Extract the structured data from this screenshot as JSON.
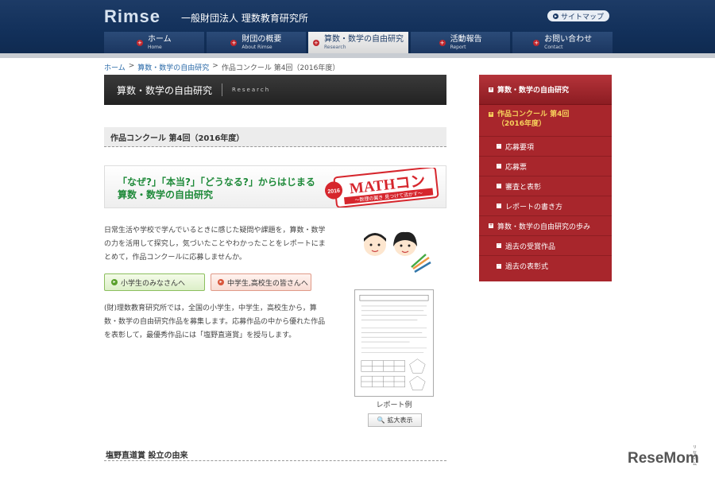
{
  "header": {
    "logo": "Rimse",
    "org_name": "一般財団法人 理数教育研究所",
    "sitemap": "サイトマップ"
  },
  "nav": [
    {
      "jp": "ホーム",
      "en": "Home"
    },
    {
      "jp": "財団の概要",
      "en": "About Rimse"
    },
    {
      "jp": "算数・数学の自由研究",
      "en": "Research"
    },
    {
      "jp": "活動報告",
      "en": "Report"
    },
    {
      "jp": "お問い合わせ",
      "en": "Contact"
    }
  ],
  "breadcrumb": {
    "home": "ホーム",
    "sep": ">",
    "research": "算数・数学の自由研究",
    "current": "作品コンクール 第4回（2016年度）"
  },
  "section_head": {
    "jp": "算数・数学の自由研究",
    "en": "Research"
  },
  "page_title": "作品コンクール 第4回（2016年度）",
  "banner": {
    "line1": "「なぜ?」「本当?」「どうなる?」からはじまる",
    "line2": "算数・数学の自由研究",
    "logo_year": "2016",
    "logo_main": "MATHコン",
    "logo_sub": "〜数理の翼き 見つけて活かす〜"
  },
  "intro": "日常生活や学校で学んでいるときに感じた疑問や課題を，算数・数学の力を活用して探究し，気づいたことやわかったことをレポートにまとめて，作品コンクールに応募しませんか。",
  "buttons": {
    "elementary": "小学生のみなさんへ",
    "secondary": "中学生,高校生の皆さんへ"
  },
  "description": "(財)理数教育研究所では，全国の小学生，中学生，高校生から，算数・数学の自由研究作品を募集します。応募作品の中から優れた作品を表彰して，最優秀作品には「塩野直道賞」を授与します。",
  "report": {
    "caption": "レポート例",
    "zoom": "拡大表示"
  },
  "section2_title": "塩野直道賞 設立の由来",
  "sidebar": {
    "head": "算数・数学の自由研究",
    "selected_line1": "作品コンクール 第4回",
    "selected_line2": "（2016年度）",
    "sub": [
      "応募要項",
      "応募票",
      "審査と表彰",
      "レポートの書き方"
    ],
    "main2": "算数・数学の自由研究の歩み",
    "sub2": [
      "過去の受賞作品",
      "過去の表彰式"
    ]
  },
  "watermark": {
    "main": "ReseMom",
    "small": "リセマム"
  },
  "colors": {
    "header": "#12305a",
    "sidebar": "#a8262c",
    "accent_green": "#1f8a3a",
    "accent_yellow": "#f7d25c"
  }
}
